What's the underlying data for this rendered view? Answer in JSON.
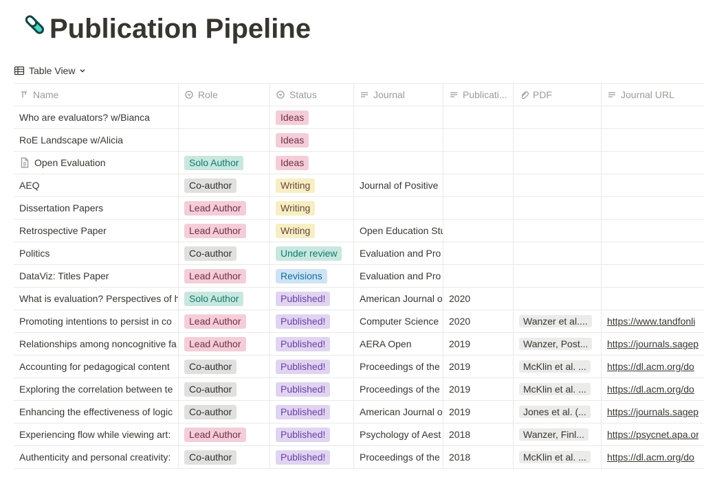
{
  "title": "Publication Pipeline",
  "view": {
    "label": "Table View"
  },
  "columns": {
    "name": "Name",
    "role": "Role",
    "status": "Status",
    "journal": "Journal",
    "publication": "Publicati...",
    "pdf": "PDF",
    "journal_url": "Journal URL"
  },
  "roleColors": {
    "Solo Author": "teal",
    "Co-author": "gray",
    "Lead Author": "pink"
  },
  "statusColors": {
    "Ideas": "pink",
    "Writing": "yellow",
    "Under review": "teal",
    "Revisions": "blue",
    "Published!": "purple"
  },
  "rows": [
    {
      "name": "Who are evaluators? w/Bianca",
      "role": "",
      "status": "Ideas",
      "journal": "",
      "publication": "",
      "pdf": "",
      "url": "",
      "hasIcon": false
    },
    {
      "name": "RoE Landscape w/Alicia",
      "role": "",
      "status": "Ideas",
      "journal": "",
      "publication": "",
      "pdf": "",
      "url": "",
      "hasIcon": false
    },
    {
      "name": "Open Evaluation",
      "role": "Solo Author",
      "status": "Ideas",
      "journal": "",
      "publication": "",
      "pdf": "",
      "url": "",
      "hasIcon": true
    },
    {
      "name": "AEQ",
      "role": "Co-author",
      "status": "Writing",
      "journal": "Journal of Positive ",
      "publication": "",
      "pdf": "",
      "url": "",
      "hasIcon": false
    },
    {
      "name": "Dissertation Papers",
      "role": "Lead Author",
      "status": "Writing",
      "journal": "",
      "publication": "",
      "pdf": "",
      "url": "",
      "hasIcon": false
    },
    {
      "name": "Retrospective Paper",
      "role": "Lead Author",
      "status": "Writing",
      "journal": "Open Education Stu",
      "publication": "",
      "pdf": "",
      "url": "",
      "hasIcon": false
    },
    {
      "name": "Politics",
      "role": "Co-author",
      "status": "Under review",
      "journal": "Evaluation and Pro",
      "publication": "",
      "pdf": "",
      "url": "",
      "hasIcon": false
    },
    {
      "name": "DataViz: Titles Paper",
      "role": "Lead Author",
      "status": "Revisions",
      "journal": "Evaluation and Pro",
      "publication": "",
      "pdf": "",
      "url": "",
      "hasIcon": false
    },
    {
      "name": "What is evaluation? Perspectives of h",
      "role": "Solo Author",
      "status": "Published!",
      "journal": "American Journal o",
      "publication": "2020",
      "pdf": "",
      "url": "",
      "hasIcon": false
    },
    {
      "name": "Promoting intentions to persist in co",
      "role": "Lead Author",
      "status": "Published!",
      "journal": "Computer Science",
      "publication": "2020",
      "pdf": "Wanzer et al....",
      "url": "https://www.tandfonli",
      "hasIcon": false
    },
    {
      "name": "Relationships among noncognitive fa",
      "role": "Lead Author",
      "status": "Published!",
      "journal": "AERA Open",
      "publication": "2019",
      "pdf": "Wanzer, Post...",
      "url": "https://journals.sagep",
      "hasIcon": false
    },
    {
      "name": "Accounting for pedagogical content",
      "role": "Co-author",
      "status": "Published!",
      "journal": "Proceedings of the",
      "publication": "2019",
      "pdf": "McKlin et al. ...",
      "url": "https://dl.acm.org/do",
      "hasIcon": false
    },
    {
      "name": "Exploring the correlation between te",
      "role": "Co-author",
      "status": "Published!",
      "journal": "Proceedings of the",
      "publication": "2019",
      "pdf": "McKlin et al. ...",
      "url": "https://dl.acm.org/do",
      "hasIcon": false
    },
    {
      "name": "Enhancing the effectiveness of logic ",
      "role": "Co-author",
      "status": "Published!",
      "journal": "American Journal o",
      "publication": "2019",
      "pdf": "Jones et al. (...",
      "url": "https://journals.sagep",
      "hasIcon": false
    },
    {
      "name": "Experiencing flow while viewing art:",
      "role": "Lead Author",
      "status": "Published!",
      "journal": "Psychology of Aest",
      "publication": "2018",
      "pdf": "Wanzer, Finl...",
      "url": "https://psycnet.apa.or",
      "hasIcon": false
    },
    {
      "name": "Authenticity and personal creativity:",
      "role": "Co-author",
      "status": "Published!",
      "journal": "Proceedings of the",
      "publication": "2018",
      "pdf": "McKlin et al. ...",
      "url": "https://dl.acm.org/do",
      "hasIcon": false
    }
  ]
}
